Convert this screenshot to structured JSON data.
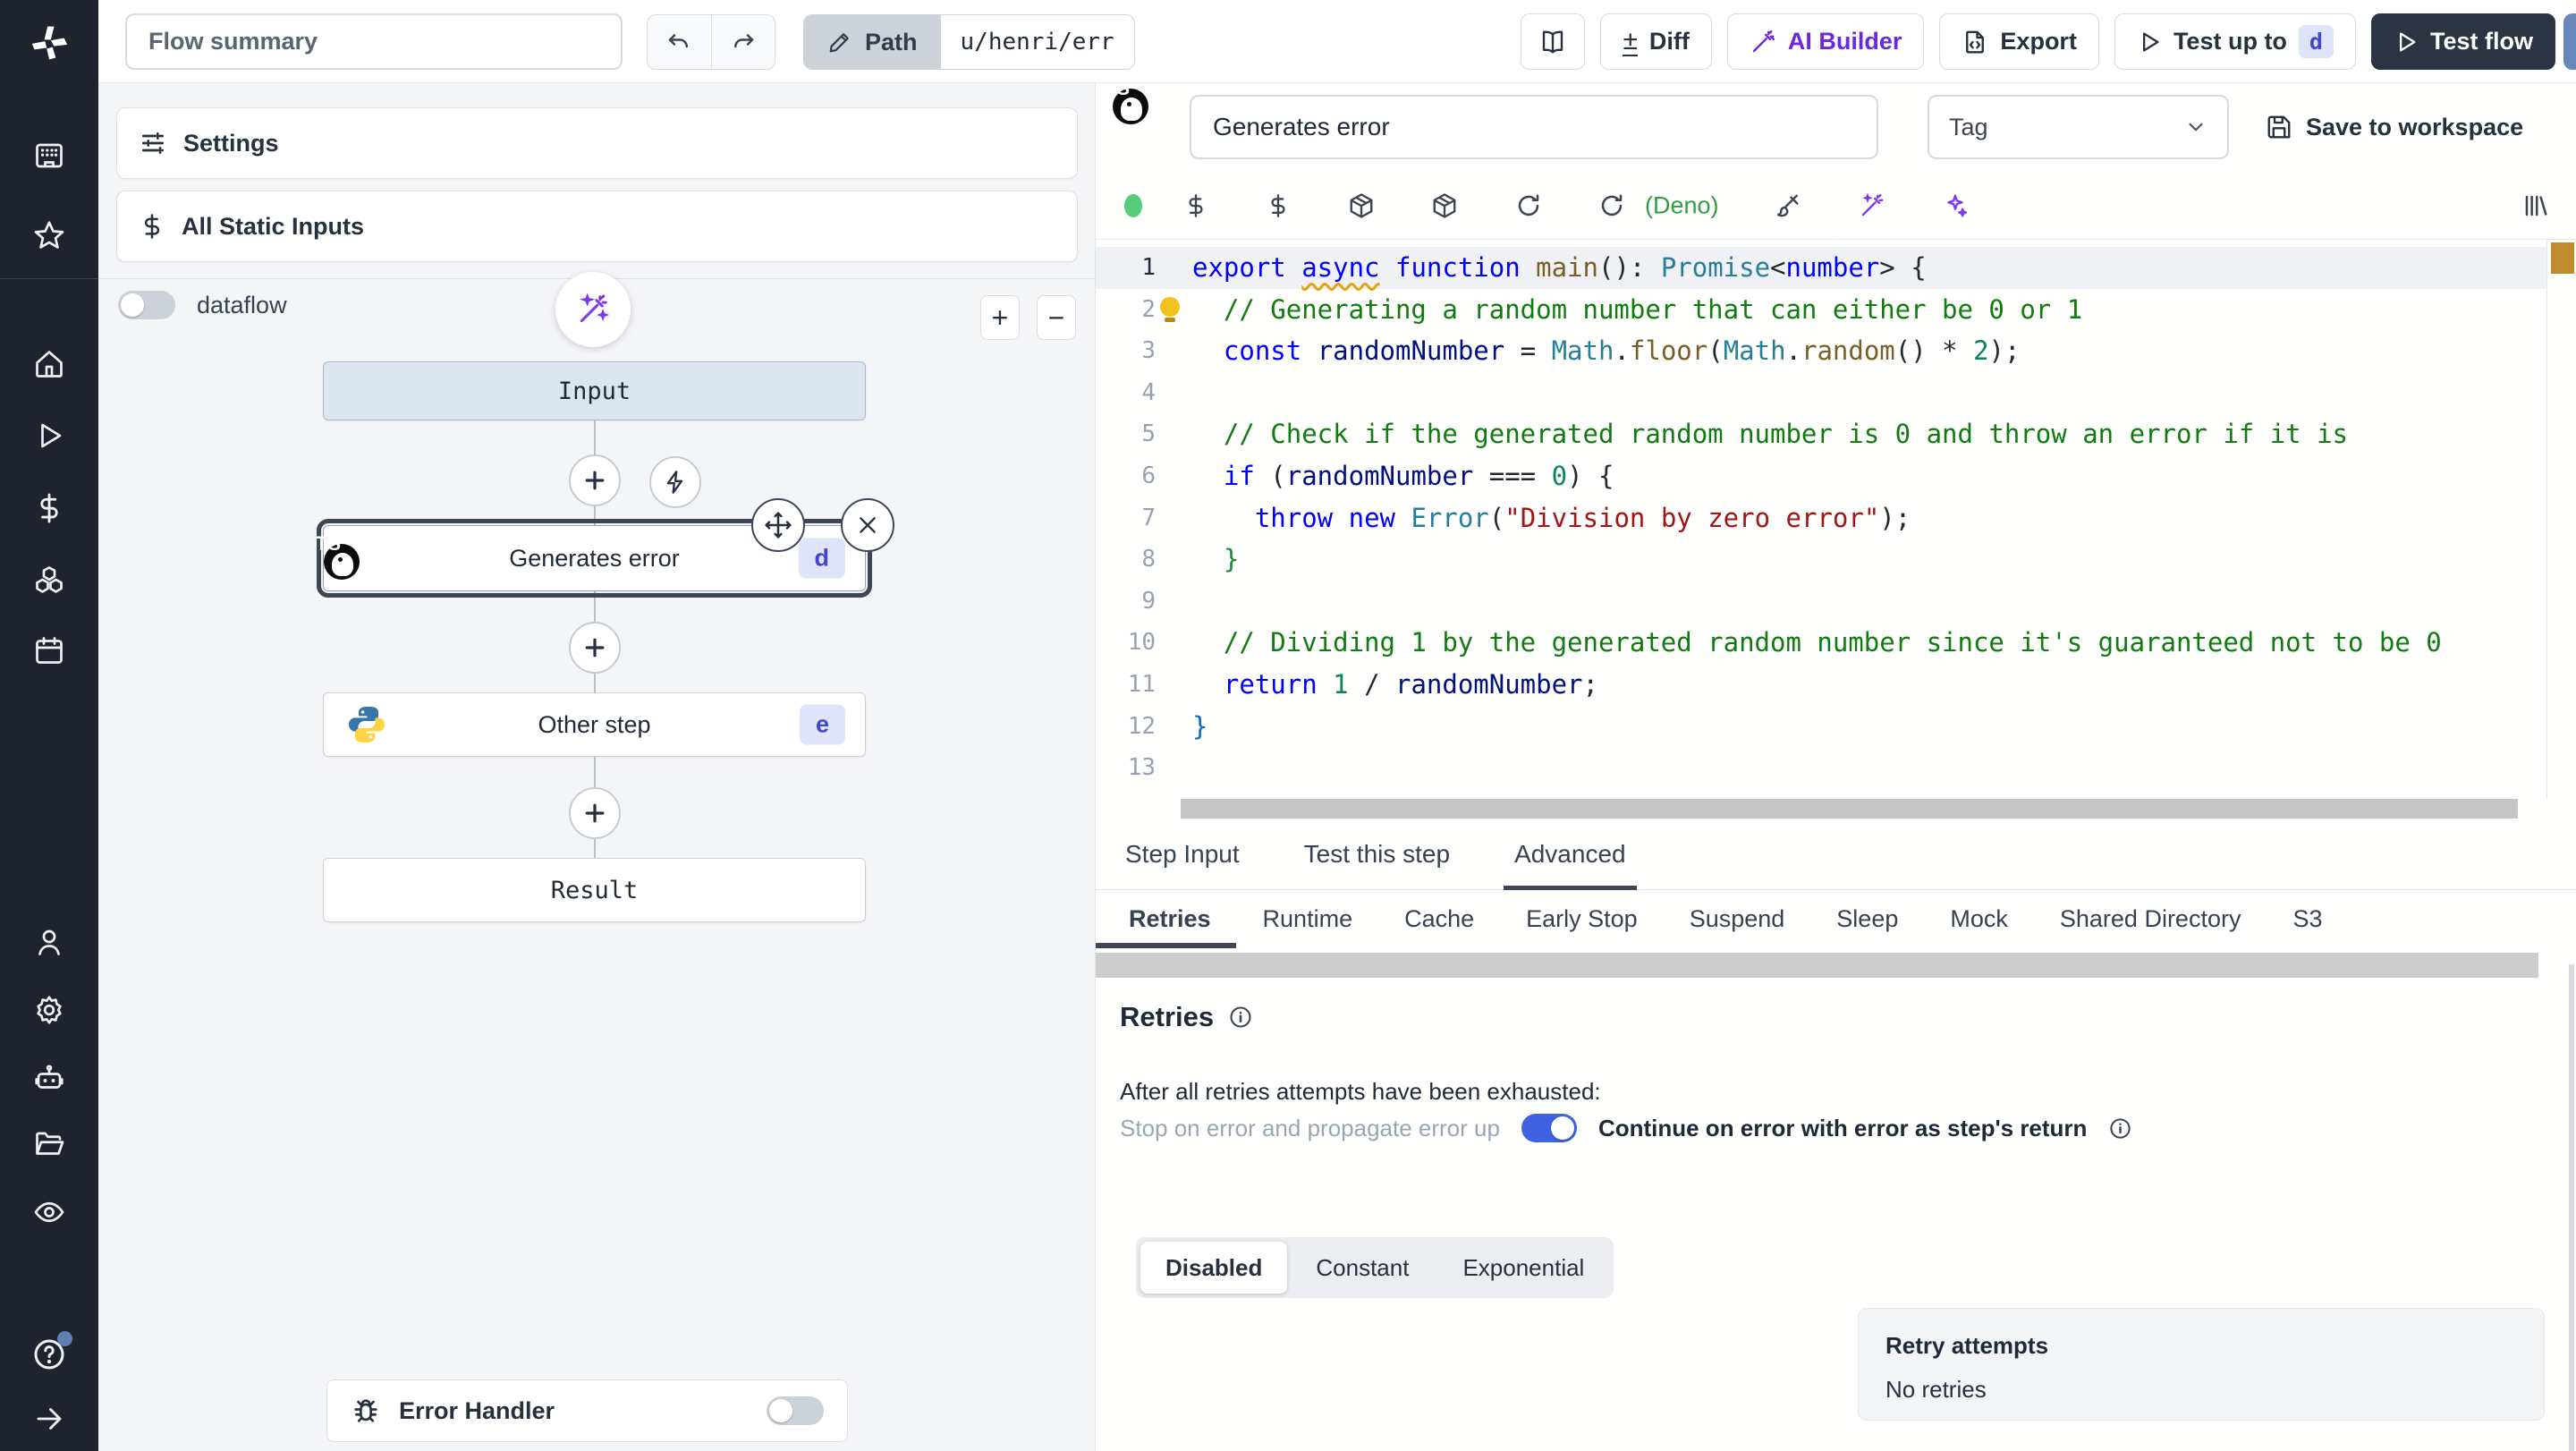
{
  "topbar": {
    "flow_summary_placeholder": "Flow summary",
    "path_label": "Path",
    "path_value": "u/henri/err",
    "diff_label": "Diff",
    "diff_plusminus": "±",
    "ai_builder_label": "AI Builder",
    "export_label": "Export",
    "test_up_to_label": "Test up to",
    "test_up_to_badge": "d",
    "test_flow_label": "Test flow"
  },
  "flow_panel": {
    "settings_label": "Settings",
    "static_inputs_label": "All Static Inputs",
    "dataflow_label": "dataflow",
    "zoom_in": "+",
    "zoom_out": "−",
    "nodes": {
      "input_label": "Input",
      "step1_title": "Generates error",
      "step1_badge": "d",
      "step2_title": "Other step",
      "step2_badge": "e",
      "result_label": "Result",
      "error_handler_label": "Error Handler"
    }
  },
  "editor": {
    "step_title_value": "Generates error",
    "tag_placeholder": "Tag",
    "save_label": "Save to workspace",
    "deno_label": "(Deno)",
    "code": {
      "lines": [
        {
          "n": 1,
          "hl": true,
          "seg": [
            [
              "k",
              "export "
            ],
            [
              "k squiggle",
              "async"
            ],
            [
              "k",
              " function "
            ],
            [
              "fn",
              "main"
            ],
            [
              "p",
              "(): "
            ],
            [
              "ty",
              "Promise"
            ],
            [
              "p",
              "<"
            ],
            [
              "k",
              "number"
            ],
            [
              "p",
              "> {"
            ]
          ]
        },
        {
          "n": 2,
          "bulb": true,
          "seg": [
            [
              "cm",
              "  // Generating a random number that can either be 0 or 1"
            ]
          ]
        },
        {
          "n": 3,
          "seg": [
            [
              "k",
              "  const "
            ],
            [
              "v",
              "randomNumber"
            ],
            [
              "p",
              " = "
            ],
            [
              "ty",
              "Math"
            ],
            [
              "p",
              "."
            ],
            [
              "fn",
              "floor"
            ],
            [
              "p",
              "("
            ],
            [
              "ty",
              "Math"
            ],
            [
              "p",
              "."
            ],
            [
              "fn",
              "random"
            ],
            [
              "p",
              "() "
            ],
            [
              "p",
              "* "
            ],
            [
              "num",
              "2"
            ],
            [
              "p",
              ");"
            ]
          ]
        },
        {
          "n": 4,
          "seg": []
        },
        {
          "n": 5,
          "seg": [
            [
              "cm",
              "  // Check if the generated random number is 0 and throw an error if it is"
            ]
          ]
        },
        {
          "n": 6,
          "seg": [
            [
              "k",
              "  if"
            ],
            [
              "p",
              " ("
            ],
            [
              "v",
              "randomNumber"
            ],
            [
              "p",
              " === "
            ],
            [
              "num",
              "0"
            ],
            [
              "p",
              ") {"
            ]
          ]
        },
        {
          "n": 7,
          "seg": [
            [
              "k",
              "    throw"
            ],
            [
              "p",
              " "
            ],
            [
              "k",
              "new"
            ],
            [
              "p",
              " "
            ],
            [
              "ty",
              "Error"
            ],
            [
              "p",
              "("
            ],
            [
              "str",
              "\"Division by zero error\""
            ],
            [
              "p",
              ");"
            ]
          ]
        },
        {
          "n": 8,
          "seg": [
            [
              "brg",
              "  }"
            ]
          ]
        },
        {
          "n": 9,
          "seg": []
        },
        {
          "n": 10,
          "seg": [
            [
              "cm",
              "  // Dividing 1 by the generated random number since it's guaranteed not to be 0"
            ]
          ]
        },
        {
          "n": 11,
          "seg": [
            [
              "k",
              "  return "
            ],
            [
              "num",
              "1"
            ],
            [
              "p",
              " / "
            ],
            [
              "v",
              "randomNumber"
            ],
            [
              "p",
              ";"
            ]
          ]
        },
        {
          "n": 12,
          "seg": [
            [
              "brb",
              "}"
            ]
          ]
        },
        {
          "n": 13,
          "seg": []
        }
      ]
    },
    "tabs": [
      "Step Input",
      "Test this step",
      "Advanced"
    ],
    "active_tab_index": 2,
    "subtabs": [
      "Retries",
      "Runtime",
      "Cache",
      "Early Stop",
      "Suspend",
      "Sleep",
      "Mock",
      "Shared Directory",
      "S3"
    ],
    "active_subtab_index": 0,
    "retries": {
      "heading": "Retries",
      "exhausted_text": "After all retries attempts have been exhausted:",
      "stop_label": "Stop on error and propagate error up",
      "continue_label": "Continue on error with error as step's return",
      "strategy_options": [
        "Disabled",
        "Constant",
        "Exponential"
      ],
      "active_strategy_index": 0,
      "retry_attempts_title": "Retry attempts",
      "retry_attempts_value": "No retries"
    }
  },
  "colors": {
    "accent_purple": "#7c3aed",
    "toggle_on_blue": "#3f63e0",
    "badge_bg": "#dfe4fb",
    "badge_text": "#4149c8",
    "deno_green": "#2f9e44",
    "sidebar_bg": "#1e232e",
    "warning_marker": "#c08b2d"
  }
}
